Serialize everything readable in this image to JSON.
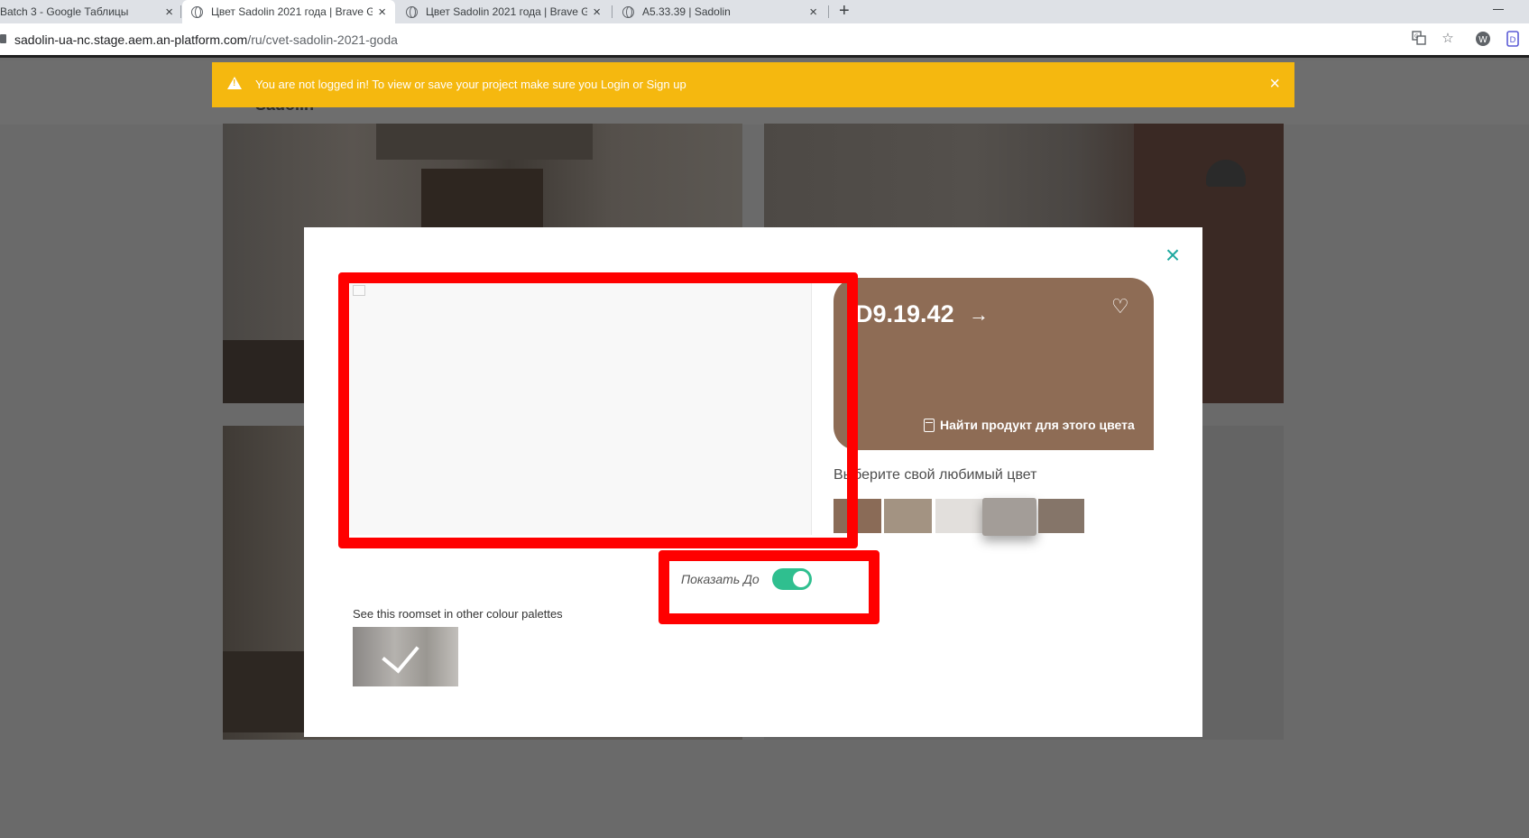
{
  "browser": {
    "tabs": [
      {
        "title": "Batch 3 - Google Таблицы",
        "active": false
      },
      {
        "title": "Цвет Sadolin 2021 года | Brave G",
        "active": true
      },
      {
        "title": "Цвет Sadolin 2021 года | Brave G",
        "active": false
      },
      {
        "title": "A5.33.39 | Sadolin",
        "active": false
      }
    ],
    "close_glyph": "×",
    "new_tab_glyph": "+",
    "url_host": "sadolin-ua-nc.stage.aem.an-platform.com",
    "url_path": "/ru/cvet-sadolin-2021-goda",
    "toolbar_icons": [
      "translate-icon",
      "star-icon",
      "extension-icon",
      "bookmark-icon"
    ]
  },
  "page": {
    "brand": "Sadolin"
  },
  "banner": {
    "message": "You are not logged in! To view or save your project make sure you Login or Sign up",
    "close_glyph": "×",
    "color": "#f5b80f"
  },
  "modal": {
    "close_glyph": "×",
    "color_card": {
      "code": "D9.19.42",
      "arrow_glyph": "→",
      "heart_glyph": "♡",
      "find_product_label": "Найти продукт для этого цвета",
      "color": "#8e6c55"
    },
    "pick_color_label": "Выберите свой любимый цвет",
    "swatches": [
      {
        "color": "#8a6b57",
        "selected": false
      },
      {
        "color": "#a39382",
        "selected": false
      },
      {
        "color": "#e2dfdc",
        "selected": false
      },
      {
        "color": "#a39d98",
        "selected": true
      },
      {
        "color": "#857569",
        "selected": false
      }
    ],
    "toggle": {
      "label": "Показать До",
      "on": true,
      "color": "#2fbf8f"
    },
    "roomset_label": "See this roomset in other colour palettes"
  },
  "annotations": {
    "color": "#ff0000"
  }
}
